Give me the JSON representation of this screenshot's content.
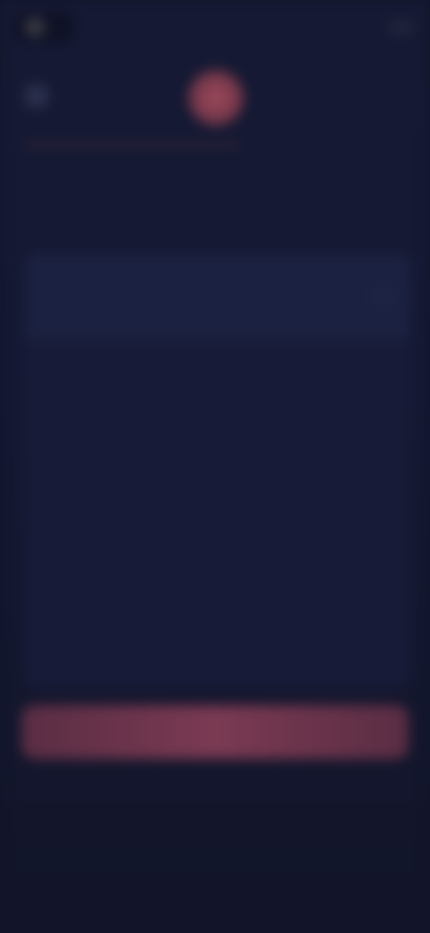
{
  "header": {
    "brand_label": "",
    "top_right_label": ""
  },
  "question": {
    "text": ""
  },
  "options": [
    {
      "label": ""
    },
    {
      "label": ""
    },
    {
      "label": ""
    },
    {
      "label": ""
    },
    {
      "label": ""
    }
  ],
  "footer": {
    "continue_label": ""
  },
  "colors": {
    "background": "#12152a",
    "accent": "#7a3a52",
    "card": "#171b37"
  }
}
